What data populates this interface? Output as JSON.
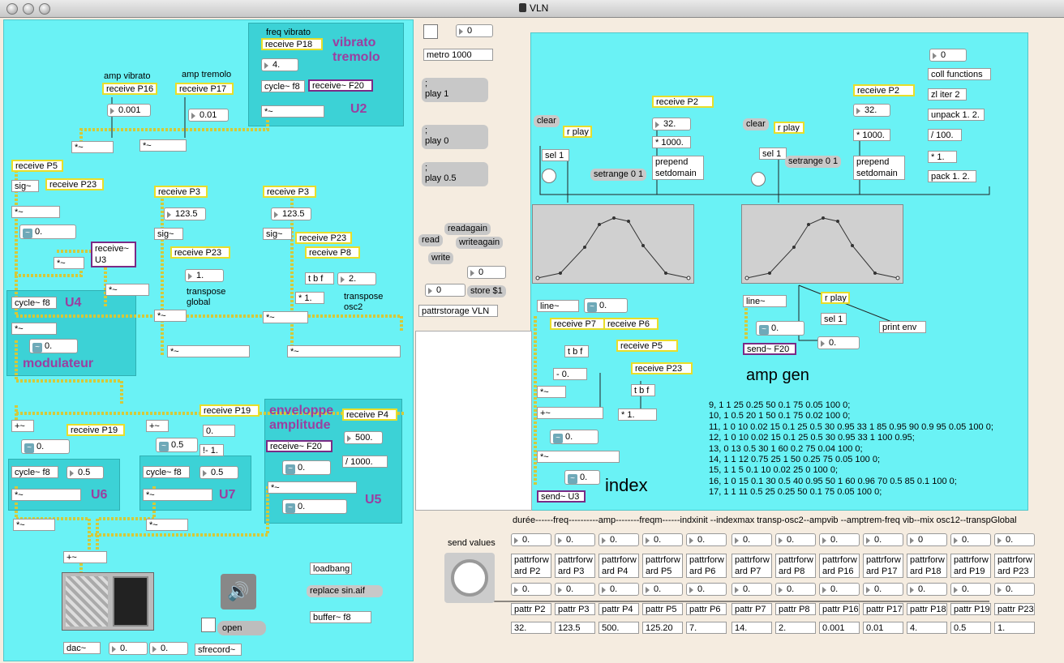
{
  "window": {
    "title": "VLN"
  },
  "labels": {
    "vibrato_tremolo": "vibrato\ntremolo",
    "u2": "U2",
    "u4": "U4",
    "modulateur": "modulateur",
    "u6": "U6",
    "u7": "U7",
    "u5": "U5",
    "env_amp": "enveloppe\namplitude",
    "index": "index",
    "amp_gen": "amp gen"
  },
  "comments": {
    "freq_vibrato": "freq vibrato",
    "amp_vibrato": "amp vibrato",
    "amp_tremolo": "amp tremolo",
    "transpose_global": "transpose\nglobal",
    "transpose_osc2": "transpose\nosc2",
    "send_values": "send values",
    "header_row": "durée------freq----------amp--------freqm------indxinit --indexmax  transp-osc2--ampvib --amptrem-freq vib--mix osc12--transpGlobal"
  },
  "objects": {
    "recv_p18": "receive P18",
    "cycle_f8_a": "cycle~ f8",
    "recv_f20": "receive~ F20",
    "mul_a": "*~",
    "recv_p16": "receive P16",
    "recv_p17": "receive P17",
    "mul_b": "*~",
    "mul_c": "*~",
    "recv_p5": "receive P5",
    "sig_a": "sig~",
    "recv_p23_a": "receive P23",
    "mul_d": "*~",
    "mul_e": "*~",
    "recv_u3": "receive~\nU3",
    "mul_f": "*~",
    "recv_p3_a": "receive P3",
    "sig_b": "sig~",
    "recv_p23_b": "receive P23",
    "mul_g": "*~",
    "mul_h": "*~",
    "recv_p3_b": "receive P3",
    "sig_c": "sig~",
    "recv_p23_c": "receive P23",
    "recv_p8": "receive P8",
    "tbf_a": "t b f",
    "mul_i": "* 1.",
    "mul_j": "*~",
    "mul_k": "*~",
    "cycle_f8_b": "cycle~ f8",
    "mul_l": "*~",
    "plus_a": "+~",
    "recv_p19_a": "receive P19",
    "cycle_f8_c": "cycle~ f8",
    "mul_m": "*~",
    "plus_b": "+~",
    "recv_p19_b": "receive P19",
    "minus_1": "!- 1.",
    "cycle_f8_d": "cycle~ f8",
    "mul_n": "*~",
    "recv_f20_b": "receive~ F20",
    "recv_p4": "receive P4",
    "div_1000": "/ 1000.",
    "mul_o": "*~",
    "mul_p": "*~",
    "mul_q": "*~",
    "plus_c": "+~",
    "dac": "dac~",
    "loadbang": "loadbang",
    "buffer": "buffer~ f8",
    "sfrecord": "sfrecord~",
    "metro": "metro 1000",
    "pattrstorage": "pattrstorage VLN",
    "recv_p2_a": "receive P2",
    "mul_1000_a": "* 1000.",
    "prepend_a": "prepend\nsetdomain",
    "rplay_a": "r play",
    "sel_a": "sel 1",
    "line_a": "line~",
    "recv_p7": "receive P7",
    "recv_p6": "receive P6",
    "tbf_b": "t b f",
    "minus_0": "- 0.",
    "mul_r": "*~",
    "plus_d": "+~",
    "recv_p5_b": "receive P5",
    "recv_p23_d": "receive P23",
    "tbf_c": "t b f",
    "mul_s": "* 1.",
    "mul_t": "*~",
    "send_u3": "send~ U3",
    "coll": "coll functions",
    "zl": "zl iter 2",
    "unpack": "unpack 1. 2.",
    "div_100": "/ 100.",
    "mul_1": "* 1.",
    "pack": "pack 1. 2.",
    "recv_p2_b": "receive P2",
    "mul_1000_b": "* 1000.",
    "prepend_b": "prepend\nsetdomain",
    "rplay_b": "r play",
    "sel_b": "sel 1",
    "line_b": "line~",
    "send_f20": "send~ F20",
    "rplay_c": "r play",
    "sel_c": "sel 1",
    "print_env": "print env"
  },
  "numbers": {
    "amp_vib": "0.001",
    "amp_trem": "0.01",
    "freq_vib": "4.",
    "p3a": "123.5",
    "p3b": "123.5",
    "glob": "1.",
    "osc2": "2.",
    "sig_a": "0.",
    "mod": "0.",
    "u6a": "0.",
    "u6b": "0.5",
    "u7a": "0.",
    "u7b": "0.5",
    "u7c": "0.5",
    "env": "500.",
    "u5a": "0.",
    "u5b": "0.",
    "dac_l": "0.",
    "dac_r": "0.",
    "metro_in": "0",
    "store_in": "0",
    "store_num": "0",
    "p2a": "32.",
    "p2b": "32.",
    "coll_in": "0",
    "line_a": "0.",
    "idx_a": "0.",
    "idx_b": "0.",
    "ampgen": "0.",
    "ampgen_b": "0."
  },
  "messages": {
    "play1": ";\nplay 1",
    "play0": ";\nplay 0",
    "play05": ";\nplay 0.5",
    "read": "read",
    "write": "write",
    "readagain": "readagain",
    "writeagain": "writeagain",
    "store": "store $1",
    "clear_a": "clear",
    "setrange_a": "setrange 0 1",
    "clear_b": "clear",
    "setrange_b": "setrange 0 1",
    "replace": "replace sin.aif",
    "open": "open"
  },
  "coll_text": [
    "9, 1 1 25 0.25 50 0.1 75 0.05 100 0;",
    "10, 1 0.5 20 1 50 0.1 75 0.02 100 0;",
    "11, 1 0 10 0.02 15 0.1 25 0.5 30 0.95 33 1 85 0.95 90 0.9 95 0.05 100 0;",
    "12, 1 0 10 0.02 15 0.1 25 0.5 30 0.95 33 1 100 0.95;",
    "13, 0 13 0.5 30 1 60 0.2 75 0.04 100 0;",
    "14, 1 1 12 0.75 25 1 50 0.25 75 0.05 100 0;",
    "15, 1 1 5 0.1 10 0.02 25 0 100 0;",
    "16, 1 0 15 0.1 30 0.5 40 0.95 50 1 60 0.96 70 0.5 85 0.1 100 0;",
    "17, 1 1 11 0.5 25 0.25 50 0.1 75 0.05 100 0;"
  ],
  "params": [
    {
      "fwd": "pattrforw\nard P2",
      "attr": "pattr P2",
      "value": "32."
    },
    {
      "fwd": "pattrforw\nard P3",
      "attr": "pattr P3",
      "value": "123.5"
    },
    {
      "fwd": "pattrforw\nard P4",
      "attr": "pattr P4",
      "value": "500."
    },
    {
      "fwd": "pattrforw\nard P5",
      "attr": "pattr P5",
      "value": "125.20"
    },
    {
      "fwd": "pattrforw\nard P6",
      "attr": "pattr P6",
      "value": "7."
    },
    {
      "fwd": "pattrforw\nard P7",
      "attr": "pattr P7",
      "value": "14."
    },
    {
      "fwd": "pattrforw\nard P8",
      "attr": "pattr P8",
      "value": "2."
    },
    {
      "fwd": "pattrforw\nard P16",
      "attr": "pattr P16",
      "value": "0.001"
    },
    {
      "fwd": "pattrforw\nard P17",
      "attr": "pattr P17",
      "value": "0.01"
    },
    {
      "fwd": "pattrforw\nard P18",
      "attr": "pattr P18",
      "value": "4."
    },
    {
      "fwd": "pattrforw\nard P19",
      "attr": "pattr P19",
      "value": "0.5"
    },
    {
      "fwd": "pattrforw\nard P23",
      "attr": "pattr P23",
      "value": "1."
    }
  ],
  "param_inputs": [
    "0.",
    "0.",
    "0.",
    "0.",
    "0.",
    "0.",
    "0.",
    "0.",
    "0.",
    "0",
    "0.",
    "0."
  ],
  "param_mids": [
    "0.",
    "0.",
    "0.",
    "0.",
    "0.",
    "0.",
    "0.",
    "0.",
    "0.",
    "0.",
    "0.",
    "0."
  ],
  "colors": {
    "panel": "#6af2f5",
    "panel_dark": "#3cd2d6",
    "receive_border": "#e8dd2a",
    "signal_border": "#7a2b86",
    "label_purple": "#9a3fa0",
    "background": "#f5ece0"
  }
}
